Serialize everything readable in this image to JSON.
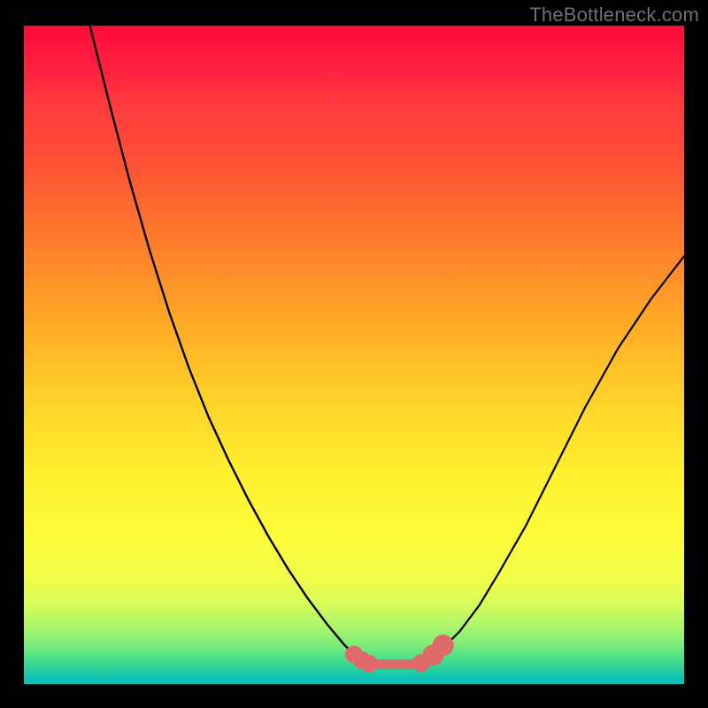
{
  "watermark": "TheBottleneck.com",
  "chart_data": {
    "type": "line",
    "title": "",
    "xlabel": "",
    "ylabel": "",
    "xlim": [
      0,
      100
    ],
    "ylim": [
      0,
      100
    ],
    "grid": false,
    "series": [
      {
        "name": "left-curve",
        "stroke": "#000000",
        "x": [
          10.0,
          13.0,
          16.0,
          19.0,
          22.0,
          25.0,
          28.0,
          31.0,
          34.0,
          37.0,
          40.0,
          43.0,
          46.0,
          48.5,
          50.5,
          52.0
        ],
        "y": [
          100.0,
          88.0,
          76.5,
          66.0,
          56.5,
          48.0,
          40.5,
          34.0,
          28.0,
          22.5,
          17.5,
          13.0,
          9.0,
          6.0,
          4.0,
          3.0
        ]
      },
      {
        "name": "right-curve",
        "stroke": "#000000",
        "x": [
          60.0,
          63.0,
          66.0,
          69.0,
          72.0,
          76.0,
          80.0,
          85.0,
          90.0,
          95.0,
          100.0
        ],
        "y": [
          3.0,
          5.0,
          8.0,
          12.0,
          17.0,
          24.0,
          32.0,
          42.0,
          51.0,
          58.5,
          65.0
        ]
      },
      {
        "name": "valley-floor",
        "stroke": "#e06a6a",
        "x": [
          52.0,
          60.0
        ],
        "y": [
          3.0,
          3.0
        ]
      }
    ],
    "markers": [
      {
        "name": "left-threshold-dot-1",
        "x": 50.0,
        "y": 4.5,
        "color": "#e06a6a",
        "r": 0.9
      },
      {
        "name": "left-threshold-dot-2",
        "x": 51.2,
        "y": 3.6,
        "color": "#e06a6a",
        "r": 0.9
      },
      {
        "name": "left-threshold-dot-3",
        "x": 52.3,
        "y": 3.1,
        "color": "#e06a6a",
        "r": 0.9
      },
      {
        "name": "right-threshold-dot-1",
        "x": 60.2,
        "y": 3.2,
        "color": "#e06a6a",
        "r": 0.9
      },
      {
        "name": "right-threshold-dot-2",
        "x": 62.0,
        "y": 4.4,
        "color": "#e06a6a",
        "r": 1.2
      },
      {
        "name": "right-threshold-dot-3",
        "x": 63.5,
        "y": 5.9,
        "color": "#e06a6a",
        "r": 1.2
      }
    ],
    "background_gradient": {
      "direction": "vertical",
      "stops": [
        {
          "pos": 0.0,
          "color": "#ff0a3a"
        },
        {
          "pos": 0.32,
          "color": "#ff7a2c"
        },
        {
          "pos": 0.68,
          "color": "#fff02e"
        },
        {
          "pos": 0.88,
          "color": "#d6fb5a"
        },
        {
          "pos": 1.0,
          "color": "#0cbfb8"
        }
      ]
    }
  }
}
